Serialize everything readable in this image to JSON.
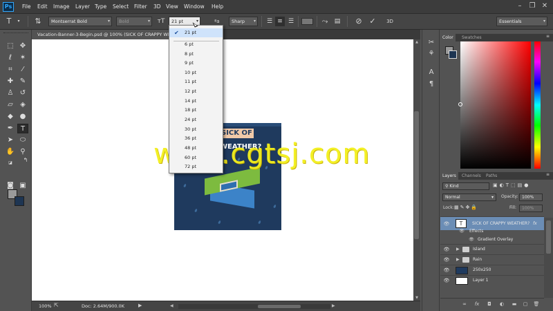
{
  "app": {
    "logo": "Ps"
  },
  "menu": [
    "File",
    "Edit",
    "Image",
    "Layer",
    "Type",
    "Select",
    "Filter",
    "3D",
    "View",
    "Window",
    "Help"
  ],
  "options": {
    "font_family": "Montserrat Bold",
    "font_style": "Bold",
    "font_size": "21 pt",
    "aa_label": "ªa",
    "anti_alias": "Sharp",
    "workspace": "Essentials"
  },
  "document": {
    "tab_title": "Vacation-Banner-3-Begin.psd @ 100% (SICK OF CRAPPY WEATHER?, RGB/8) *",
    "headline_line1": "SICK OF",
    "headline_line2": "WEATHER?"
  },
  "font_size_menu": {
    "selected": "21 pt",
    "items": [
      "6 pt",
      "8 pt",
      "9 pt",
      "10 pt",
      "11 pt",
      "12 pt",
      "14 pt",
      "18 pt",
      "24 pt",
      "30 pt",
      "36 pt",
      "48 pt",
      "60 pt",
      "72 pt"
    ]
  },
  "watermark": "www.cgtsj.com",
  "status": {
    "zoom": "100%",
    "doc": "Doc: 2.64M/900.0K"
  },
  "color_panel": {
    "tabs": [
      "Color",
      "Swatches"
    ],
    "fg_color": "#9a9a9a",
    "bg_color": "#1e3552"
  },
  "layers_panel": {
    "tabs": [
      "Layers",
      "Channels",
      "Paths"
    ],
    "filter": "Kind",
    "blend_mode": "Normal",
    "opacity_label": "Opacity:",
    "opacity": "100%",
    "lock_label": "Lock:",
    "fill_label": "Fill:",
    "fill": "100%",
    "layers": [
      {
        "name": "SICK OF CRAPPY WEATHER?",
        "kind": "text",
        "fx": "fx"
      },
      {
        "name": "Effects",
        "kind": "effects"
      },
      {
        "name": "Gradient Overlay",
        "kind": "effect"
      },
      {
        "name": "Island",
        "kind": "group"
      },
      {
        "name": "Rain",
        "kind": "group"
      },
      {
        "name": "250x250",
        "kind": "image"
      },
      {
        "name": "Layer 1",
        "kind": "fill"
      }
    ]
  }
}
